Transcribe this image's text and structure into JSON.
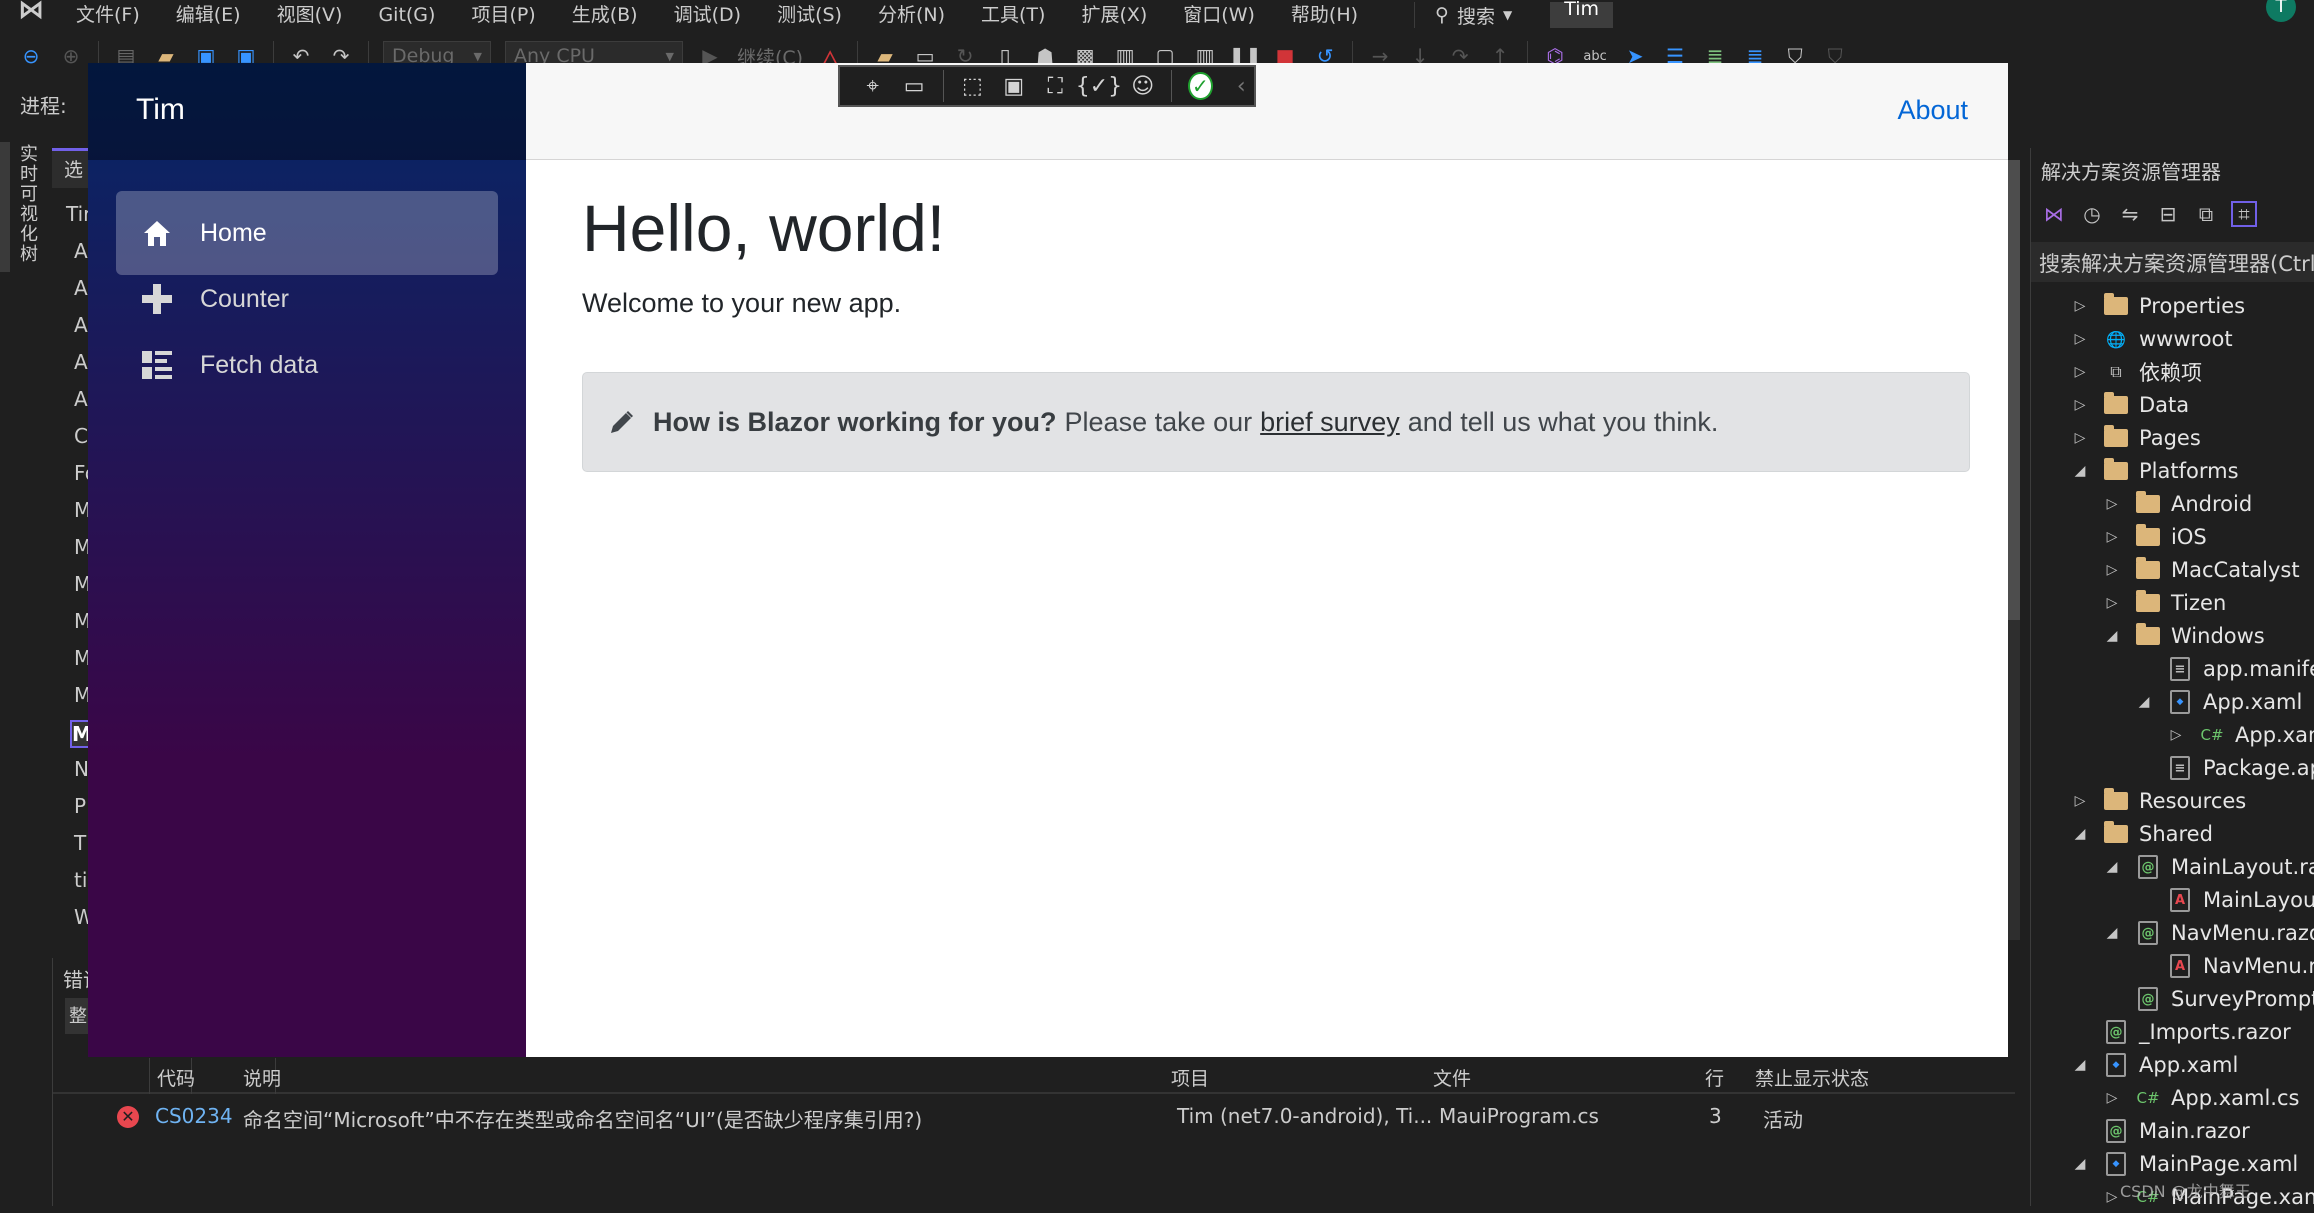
{
  "menubar": {
    "items": [
      "文件(F)",
      "编辑(E)",
      "视图(V)",
      "Git(G)",
      "项目(P)",
      "生成(B)",
      "调试(D)",
      "测试(S)",
      "分析(N)",
      "工具(T)",
      "扩展(X)",
      "窗口(W)",
      "帮助(H)"
    ],
    "search_label": "搜索",
    "solution_name": "Tim",
    "account_initial": "T"
  },
  "toolbar": {
    "config": "Debug",
    "platform": "Any CPU",
    "continue_label": "继续(C)",
    "process_label": "进程:"
  },
  "visual_tree": {
    "vertical_tab": "实时可视化树",
    "tab_label": "选",
    "items": [
      "Tir",
      "A",
      "A",
      "A",
      "A",
      "A",
      "C",
      "Fo",
      "M",
      "M",
      "M",
      "M",
      "M",
      "M",
      "M",
      "N",
      "P",
      "T",
      "ti",
      "W"
    ],
    "selected_index": 14
  },
  "app": {
    "brand": "Tim",
    "nav": [
      {
        "label": "Home",
        "icon": "home-icon",
        "active": true
      },
      {
        "label": "Counter",
        "icon": "plus-icon",
        "active": false
      },
      {
        "label": "Fetch data",
        "icon": "list-icon",
        "active": false
      }
    ],
    "about": "About",
    "heading": "Hello, world!",
    "welcome": "Welcome to your new app.",
    "survey": {
      "question": "How is Blazor working for you?",
      "pre": "Please take our",
      "link": "brief survey",
      "post": "and tell us what you think."
    }
  },
  "error_list": {
    "title": "错误列表",
    "filter_label": "整",
    "columns": [
      "代码",
      "说明",
      "项目",
      "文件",
      "行",
      "禁止显示状态"
    ],
    "rows": [
      {
        "severity": "error",
        "code": "CS0234",
        "description": "命名空间“Microsoft”中不存在类型或命名空间名“UI”(是否缺少程序集引用?)",
        "project": "Tim (net7.0-android), Ti...",
        "file": "MauiProgram.cs",
        "line": "3",
        "state": "活动"
      }
    ]
  },
  "solution_explorer": {
    "title": "解决方案资源管理器",
    "search_placeholder": "搜索解决方案资源管理器(Ctrl",
    "items": [
      {
        "label": "Properties",
        "level": 0,
        "arrow": "collapsed",
        "icon": "properties-icon"
      },
      {
        "label": "wwwroot",
        "level": 0,
        "arrow": "collapsed",
        "icon": "globe-icon"
      },
      {
        "label": "依赖项",
        "level": 0,
        "arrow": "collapsed",
        "icon": "dependencies-icon"
      },
      {
        "label": "Data",
        "level": 0,
        "arrow": "collapsed",
        "icon": "folder-icon"
      },
      {
        "label": "Pages",
        "level": 0,
        "arrow": "collapsed",
        "icon": "folder-icon"
      },
      {
        "label": "Platforms",
        "level": 0,
        "arrow": "expanded",
        "icon": "folder-icon"
      },
      {
        "label": "Android",
        "level": 1,
        "arrow": "collapsed",
        "icon": "folder-icon"
      },
      {
        "label": "iOS",
        "level": 1,
        "arrow": "collapsed",
        "icon": "folder-icon"
      },
      {
        "label": "MacCatalyst",
        "level": 1,
        "arrow": "collapsed",
        "icon": "folder-icon"
      },
      {
        "label": "Tizen",
        "level": 1,
        "arrow": "collapsed",
        "icon": "folder-icon"
      },
      {
        "label": "Windows",
        "level": 1,
        "arrow": "expanded",
        "icon": "folder-icon"
      },
      {
        "label": "app.manifest",
        "level": 2,
        "arrow": "none",
        "icon": "manifest-icon"
      },
      {
        "label": "App.xaml",
        "level": 2,
        "arrow": "expanded",
        "icon": "xaml-icon"
      },
      {
        "label": "App.xaml.cs",
        "level": 3,
        "arrow": "collapsed",
        "icon": "csharp-icon"
      },
      {
        "label": "Package.appxmanifest",
        "level": 2,
        "arrow": "none",
        "icon": "package-icon"
      },
      {
        "label": "Resources",
        "level": 0,
        "arrow": "collapsed",
        "icon": "folder-icon"
      },
      {
        "label": "Shared",
        "level": 0,
        "arrow": "expanded",
        "icon": "folder-icon"
      },
      {
        "label": "MainLayout.razor",
        "level": 1,
        "arrow": "expanded",
        "icon": "razor-icon"
      },
      {
        "label": "MainLayout.razor.css",
        "level": 2,
        "arrow": "none",
        "icon": "css-icon"
      },
      {
        "label": "NavMenu.razor",
        "level": 1,
        "arrow": "expanded",
        "icon": "razor-icon"
      },
      {
        "label": "NavMenu.razor.css",
        "level": 2,
        "arrow": "none",
        "icon": "css-icon"
      },
      {
        "label": "SurveyPrompt.razor",
        "level": 1,
        "arrow": "none",
        "icon": "razor-icon"
      },
      {
        "label": "_Imports.razor",
        "level": 0,
        "arrow": "none",
        "icon": "razor-icon"
      },
      {
        "label": "App.xaml",
        "level": 0,
        "arrow": "expanded",
        "icon": "xaml-icon"
      },
      {
        "label": "App.xaml.cs",
        "level": 1,
        "arrow": "collapsed",
        "icon": "csharp-icon"
      },
      {
        "label": "Main.razor",
        "level": 0,
        "arrow": "none",
        "icon": "razor-icon"
      },
      {
        "label": "MainPage.xaml",
        "level": 0,
        "arrow": "expanded",
        "icon": "xaml-icon"
      },
      {
        "label": "MainPage.xaml.cs",
        "level": 1,
        "arrow": "collapsed",
        "icon": "csharp-icon"
      }
    ]
  },
  "watermark": "CSDN @龙中舞王",
  "colors": {
    "accent": "#7160e8",
    "link": "#0366d6",
    "error": "#e8474f",
    "folder": "#dcb67a",
    "sidebar_top": "#052767",
    "sidebar_bottom": "#3a0647"
  }
}
